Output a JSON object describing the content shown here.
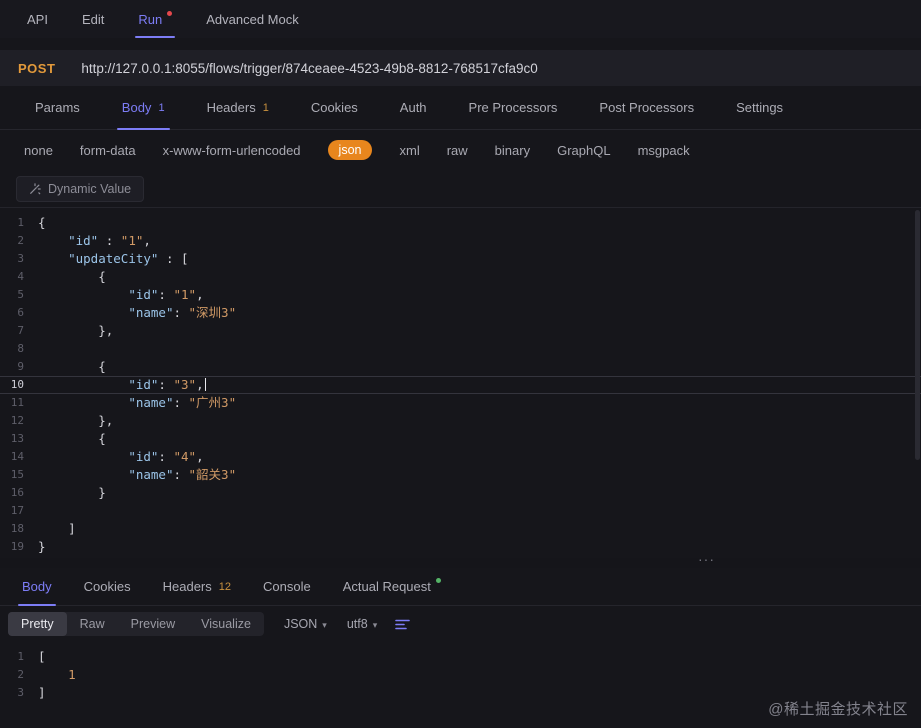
{
  "colors": {
    "accent_purple": "#7d7df6",
    "method_orange": "#e39a3b",
    "selected_pill_orange": "#e8861d",
    "count_orange": "#c9913f",
    "unsaved_dot_red": "#e5484d",
    "success_dot_green": "#55b467",
    "string_token": "#d19a66",
    "key_token": "#9bc4e8"
  },
  "top_nav": {
    "items": [
      {
        "label": "API",
        "active": false,
        "dot": false
      },
      {
        "label": "Edit",
        "active": false,
        "dot": false
      },
      {
        "label": "Run",
        "active": true,
        "dot": true,
        "dot_color": "red"
      },
      {
        "label": "Advanced Mock",
        "active": false,
        "dot": false
      }
    ]
  },
  "request_bar": {
    "method": "POST",
    "url": "http://127.0.0.1:8055/flows/trigger/874ceaee-4523-49b8-8812-768517cfa9c0"
  },
  "request_tabs": [
    {
      "label": "Params"
    },
    {
      "label": "Body",
      "count": "1",
      "active": true
    },
    {
      "label": "Headers",
      "count": "1"
    },
    {
      "label": "Cookies"
    },
    {
      "label": "Auth"
    },
    {
      "label": "Pre Processors"
    },
    {
      "label": "Post Processors"
    },
    {
      "label": "Settings"
    }
  ],
  "body_types": {
    "options": [
      "none",
      "form-data",
      "x-www-form-urlencoded",
      "json",
      "xml",
      "raw",
      "binary",
      "GraphQL",
      "msgpack"
    ],
    "selected": "json"
  },
  "editor_toolbar": {
    "dynamic_value": "Dynamic Value"
  },
  "request_editor": {
    "current_line": 10,
    "lines": [
      {
        "n": 1,
        "tokens": [
          [
            "p",
            "{"
          ]
        ]
      },
      {
        "n": 2,
        "tokens": [
          [
            "p",
            "    "
          ],
          [
            "k",
            "\"id\""
          ],
          [
            "p",
            " : "
          ],
          [
            "s",
            "\"1\""
          ],
          [
            "p",
            ","
          ]
        ]
      },
      {
        "n": 3,
        "tokens": [
          [
            "p",
            "    "
          ],
          [
            "k",
            "\"updateCity\""
          ],
          [
            "p",
            " : ["
          ]
        ]
      },
      {
        "n": 4,
        "tokens": [
          [
            "p",
            "        {"
          ]
        ]
      },
      {
        "n": 5,
        "tokens": [
          [
            "p",
            "            "
          ],
          [
            "k",
            "\"id\""
          ],
          [
            "p",
            ": "
          ],
          [
            "s",
            "\"1\""
          ],
          [
            "p",
            ","
          ]
        ]
      },
      {
        "n": 6,
        "tokens": [
          [
            "p",
            "            "
          ],
          [
            "k",
            "\"name\""
          ],
          [
            "p",
            ": "
          ],
          [
            "s",
            "\"深圳3\""
          ]
        ]
      },
      {
        "n": 7,
        "tokens": [
          [
            "p",
            "        },"
          ]
        ]
      },
      {
        "n": 8,
        "tokens": []
      },
      {
        "n": 9,
        "tokens": [
          [
            "p",
            "        {"
          ]
        ]
      },
      {
        "n": 10,
        "tokens": [
          [
            "p",
            "            "
          ],
          [
            "k",
            "\"id\""
          ],
          [
            "p",
            ": "
          ],
          [
            "s",
            "\"3\""
          ],
          [
            "p",
            ","
          ]
        ],
        "cursor": true
      },
      {
        "n": 11,
        "tokens": [
          [
            "p",
            "            "
          ],
          [
            "k",
            "\"name\""
          ],
          [
            "p",
            ": "
          ],
          [
            "s",
            "\"广州3\""
          ]
        ]
      },
      {
        "n": 12,
        "tokens": [
          [
            "p",
            "        },"
          ]
        ]
      },
      {
        "n": 13,
        "tokens": [
          [
            "p",
            "        {"
          ]
        ]
      },
      {
        "n": 14,
        "tokens": [
          [
            "p",
            "            "
          ],
          [
            "k",
            "\"id\""
          ],
          [
            "p",
            ": "
          ],
          [
            "s",
            "\"4\""
          ],
          [
            "p",
            ","
          ]
        ]
      },
      {
        "n": 15,
        "tokens": [
          [
            "p",
            "            "
          ],
          [
            "k",
            "\"name\""
          ],
          [
            "p",
            ": "
          ],
          [
            "s",
            "\"韶关3\""
          ]
        ]
      },
      {
        "n": 16,
        "tokens": [
          [
            "p",
            "        }"
          ]
        ]
      },
      {
        "n": 17,
        "tokens": []
      },
      {
        "n": 18,
        "tokens": [
          [
            "p",
            "    ]"
          ]
        ]
      },
      {
        "n": 19,
        "tokens": [
          [
            "p",
            "}"
          ]
        ]
      }
    ]
  },
  "response_tabs": [
    {
      "label": "Body",
      "active": true
    },
    {
      "label": "Cookies"
    },
    {
      "label": "Headers",
      "count": "12"
    },
    {
      "label": "Console"
    },
    {
      "label": "Actual Request",
      "dot": true,
      "dot_color": "green"
    }
  ],
  "response_toolbar": {
    "views": [
      "Pretty",
      "Raw",
      "Preview",
      "Visualize"
    ],
    "active_view": "Pretty",
    "language": "JSON",
    "encoding": "utf8"
  },
  "response_editor": {
    "current_line": 0,
    "lines": [
      {
        "n": 1,
        "tokens": [
          [
            "p",
            "["
          ]
        ]
      },
      {
        "n": 2,
        "tokens": [
          [
            "p",
            "    "
          ],
          [
            "n",
            "1"
          ]
        ]
      },
      {
        "n": 3,
        "tokens": [
          [
            "p",
            "]"
          ]
        ]
      }
    ]
  },
  "watermark": "@稀土掘金技术社区"
}
